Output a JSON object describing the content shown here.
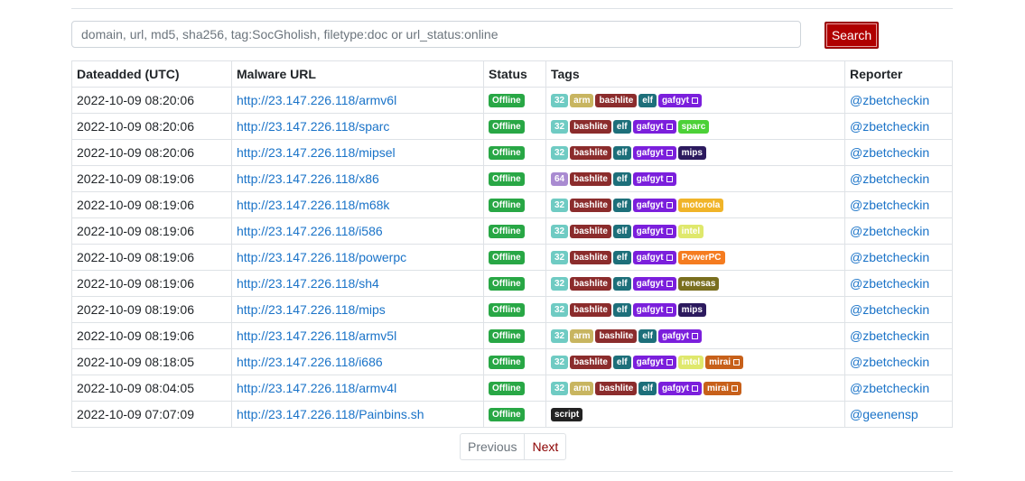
{
  "search": {
    "placeholder": "domain, url, md5, sha256, tag:SocGholish, filetype:doc or url_status:online",
    "button_label": "Search"
  },
  "table": {
    "headers": [
      "Dateadded (UTC)",
      "Malware URL",
      "Status",
      "Tags",
      "Reporter"
    ],
    "rows": [
      {
        "date": "2022-10-09 08:20:06",
        "url": "http://23.147.226.118/armv6l",
        "status": "Offline",
        "tags": [
          {
            "t": "32",
            "c": "#6fcbc3"
          },
          {
            "t": "arm",
            "c": "#c8b560"
          },
          {
            "t": "bashlite",
            "c": "#8b2c2c"
          },
          {
            "t": "elf",
            "c": "#1d6f7a"
          },
          {
            "t": "gafgyt",
            "c": "#7b1fdc",
            "ext": true
          }
        ],
        "reporter": "@zbetcheckin"
      },
      {
        "date": "2022-10-09 08:20:06",
        "url": "http://23.147.226.118/sparc",
        "status": "Offline",
        "tags": [
          {
            "t": "32",
            "c": "#6fcbc3"
          },
          {
            "t": "bashlite",
            "c": "#8b2c2c"
          },
          {
            "t": "elf",
            "c": "#1d6f7a"
          },
          {
            "t": "gafgyt",
            "c": "#7b1fdc",
            "ext": true
          },
          {
            "t": "sparc",
            "c": "#4cd137"
          }
        ],
        "reporter": "@zbetcheckin"
      },
      {
        "date": "2022-10-09 08:20:06",
        "url": "http://23.147.226.118/mipsel",
        "status": "Offline",
        "tags": [
          {
            "t": "32",
            "c": "#6fcbc3"
          },
          {
            "t": "bashlite",
            "c": "#8b2c2c"
          },
          {
            "t": "elf",
            "c": "#1d6f7a"
          },
          {
            "t": "gafgyt",
            "c": "#7b1fdc",
            "ext": true
          },
          {
            "t": "mips",
            "c": "#2c1a5e"
          }
        ],
        "reporter": "@zbetcheckin"
      },
      {
        "date": "2022-10-09 08:19:06",
        "url": "http://23.147.226.118/x86",
        "status": "Offline",
        "tags": [
          {
            "t": "64",
            "c": "#a98bd1"
          },
          {
            "t": "bashlite",
            "c": "#8b2c2c"
          },
          {
            "t": "elf",
            "c": "#1d6f7a"
          },
          {
            "t": "gafgyt",
            "c": "#7b1fdc",
            "ext": true
          }
        ],
        "reporter": "@zbetcheckin"
      },
      {
        "date": "2022-10-09 08:19:06",
        "url": "http://23.147.226.118/m68k",
        "status": "Offline",
        "tags": [
          {
            "t": "32",
            "c": "#6fcbc3"
          },
          {
            "t": "bashlite",
            "c": "#8b2c2c"
          },
          {
            "t": "elf",
            "c": "#1d6f7a"
          },
          {
            "t": "gafgyt",
            "c": "#7b1fdc",
            "ext": true
          },
          {
            "t": "motorola",
            "c": "#f0b429"
          }
        ],
        "reporter": "@zbetcheckin"
      },
      {
        "date": "2022-10-09 08:19:06",
        "url": "http://23.147.226.118/i586",
        "status": "Offline",
        "tags": [
          {
            "t": "32",
            "c": "#6fcbc3"
          },
          {
            "t": "bashlite",
            "c": "#8b2c2c"
          },
          {
            "t": "elf",
            "c": "#1d6f7a"
          },
          {
            "t": "gafgyt",
            "c": "#7b1fdc",
            "ext": true
          },
          {
            "t": "intel",
            "c": "#dfe86c"
          }
        ],
        "reporter": "@zbetcheckin"
      },
      {
        "date": "2022-10-09 08:19:06",
        "url": "http://23.147.226.118/powerpc",
        "status": "Offline",
        "tags": [
          {
            "t": "32",
            "c": "#6fcbc3"
          },
          {
            "t": "bashlite",
            "c": "#8b2c2c"
          },
          {
            "t": "elf",
            "c": "#1d6f7a"
          },
          {
            "t": "gafgyt",
            "c": "#7b1fdc",
            "ext": true
          },
          {
            "t": "PowerPC",
            "c": "#f57c20"
          }
        ],
        "reporter": "@zbetcheckin"
      },
      {
        "date": "2022-10-09 08:19:06",
        "url": "http://23.147.226.118/sh4",
        "status": "Offline",
        "tags": [
          {
            "t": "32",
            "c": "#6fcbc3"
          },
          {
            "t": "bashlite",
            "c": "#8b2c2c"
          },
          {
            "t": "elf",
            "c": "#1d6f7a"
          },
          {
            "t": "gafgyt",
            "c": "#7b1fdc",
            "ext": true
          },
          {
            "t": "renesas",
            "c": "#7a6f1f"
          }
        ],
        "reporter": "@zbetcheckin"
      },
      {
        "date": "2022-10-09 08:19:06",
        "url": "http://23.147.226.118/mips",
        "status": "Offline",
        "tags": [
          {
            "t": "32",
            "c": "#6fcbc3"
          },
          {
            "t": "bashlite",
            "c": "#8b2c2c"
          },
          {
            "t": "elf",
            "c": "#1d6f7a"
          },
          {
            "t": "gafgyt",
            "c": "#7b1fdc",
            "ext": true
          },
          {
            "t": "mips",
            "c": "#2c1a5e"
          }
        ],
        "reporter": "@zbetcheckin"
      },
      {
        "date": "2022-10-09 08:19:06",
        "url": "http://23.147.226.118/armv5l",
        "status": "Offline",
        "tags": [
          {
            "t": "32",
            "c": "#6fcbc3"
          },
          {
            "t": "arm",
            "c": "#c8b560"
          },
          {
            "t": "bashlite",
            "c": "#8b2c2c"
          },
          {
            "t": "elf",
            "c": "#1d6f7a"
          },
          {
            "t": "gafgyt",
            "c": "#7b1fdc",
            "ext": true
          }
        ],
        "reporter": "@zbetcheckin"
      },
      {
        "date": "2022-10-09 08:18:05",
        "url": "http://23.147.226.118/i686",
        "status": "Offline",
        "tags": [
          {
            "t": "32",
            "c": "#6fcbc3"
          },
          {
            "t": "bashlite",
            "c": "#8b2c2c"
          },
          {
            "t": "elf",
            "c": "#1d6f7a"
          },
          {
            "t": "gafgyt",
            "c": "#7b1fdc",
            "ext": true
          },
          {
            "t": "intel",
            "c": "#dfe86c"
          },
          {
            "t": "mirai",
            "c": "#c7601a",
            "ext": true
          }
        ],
        "reporter": "@zbetcheckin"
      },
      {
        "date": "2022-10-09 08:04:05",
        "url": "http://23.147.226.118/armv4l",
        "status": "Offline",
        "tags": [
          {
            "t": "32",
            "c": "#6fcbc3"
          },
          {
            "t": "arm",
            "c": "#c8b560"
          },
          {
            "t": "bashlite",
            "c": "#8b2c2c"
          },
          {
            "t": "elf",
            "c": "#1d6f7a"
          },
          {
            "t": "gafgyt",
            "c": "#7b1fdc",
            "ext": true
          },
          {
            "t": "mirai",
            "c": "#c7601a",
            "ext": true
          }
        ],
        "reporter": "@zbetcheckin"
      },
      {
        "date": "2022-10-09 07:07:09",
        "url": "http://23.147.226.118/Painbins.sh",
        "status": "Offline",
        "tags": [
          {
            "t": "script",
            "c": "#222222"
          }
        ],
        "reporter": "@geenensp"
      }
    ]
  },
  "pager": {
    "previous": "Previous",
    "next": "Next"
  }
}
